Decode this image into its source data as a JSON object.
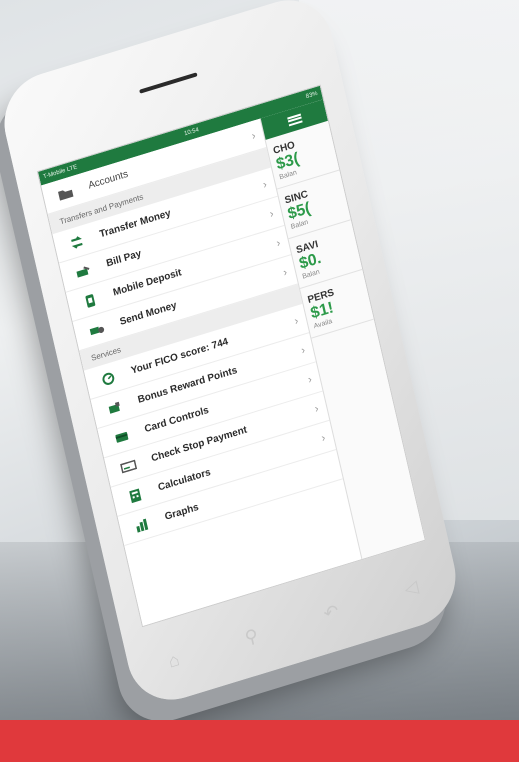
{
  "status_bar": {
    "carrier": "T-Mobile LTE",
    "time": "10:54",
    "battery": "83%"
  },
  "menu": {
    "top_item": "Accounts",
    "sections": [
      {
        "title": "Transfers and Payments",
        "items": [
          {
            "label": "Transfer Money",
            "icon": "transfer-icon"
          },
          {
            "label": "Bill Pay",
            "icon": "bill-pay-icon"
          },
          {
            "label": "Mobile Deposit",
            "icon": "mobile-deposit-icon"
          },
          {
            "label": "Send Money",
            "icon": "send-money-icon"
          }
        ]
      },
      {
        "title": "Services",
        "items": [
          {
            "label": "Your FICO score: 744",
            "icon": "fico-gauge-icon"
          },
          {
            "label": "Bonus Reward Points",
            "icon": "reward-card-icon"
          },
          {
            "label": "Card Controls",
            "icon": "card-controls-icon"
          },
          {
            "label": "Check Stop Payment",
            "icon": "check-icon"
          },
          {
            "label": "Calculators",
            "icon": "calculator-icon"
          },
          {
            "label": "Graphs",
            "icon": "graphs-icon"
          }
        ]
      }
    ]
  },
  "accounts": [
    {
      "name": "CHO",
      "amount": "$3(",
      "sub": "Balan"
    },
    {
      "name": "SINC",
      "amount": "$5(",
      "sub": "Balan"
    },
    {
      "name": "SAVI",
      "amount": "$0.",
      "sub": "Balan"
    },
    {
      "name": "PERS",
      "amount": "$1!",
      "sub": "Availa"
    }
  ],
  "colors": {
    "brand_green": "#1f7a3f",
    "amount_green": "#2c9a49",
    "band_red": "#e0393c"
  }
}
